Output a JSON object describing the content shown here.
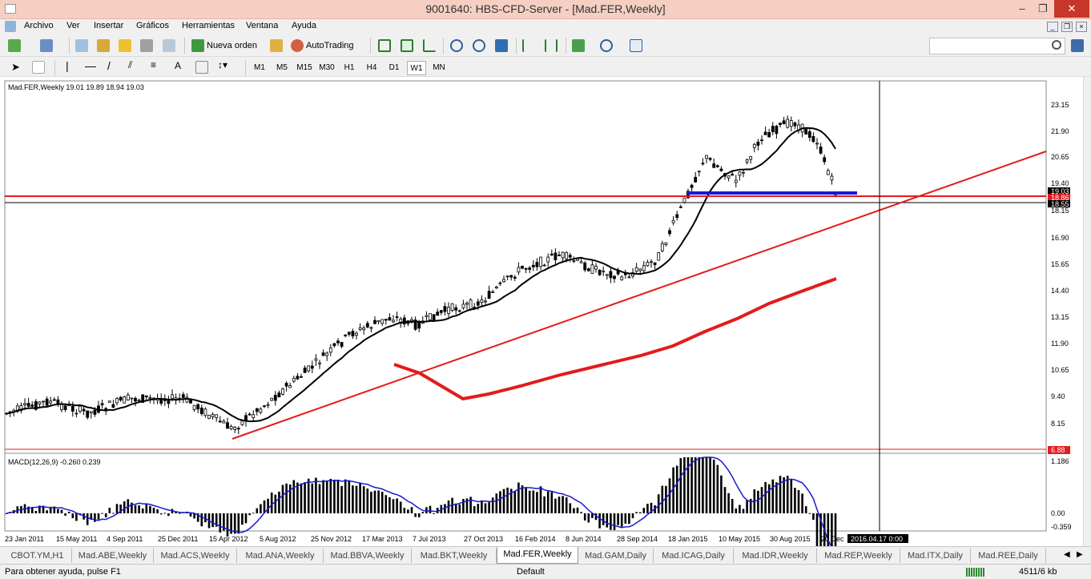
{
  "window": {
    "title": "9001640: HBS-CFD-Server - [Mad.FER,Weekly]",
    "minimize": "–",
    "restore": "❐",
    "close": "✕"
  },
  "menu": [
    "Archivo",
    "Ver",
    "Insertar",
    "Gráficos",
    "Herramientas",
    "Ventana",
    "Ayuda"
  ],
  "toolbar": {
    "new_order": "Nueva orden",
    "autotrading": "AutoTrading"
  },
  "drawing_tools": {
    "text_tool": "A"
  },
  "timeframes": [
    "M1",
    "M5",
    "M15",
    "M30",
    "H1",
    "H4",
    "D1",
    "W1",
    "MN"
  ],
  "active_timeframe": "W1",
  "chart": {
    "header": "Mad.FER,Weekly  19.01 19.89 18.94 19.03",
    "price_ticks": [
      "23.15",
      "21.90",
      "20.65",
      "19.40",
      "18.15",
      "16.90",
      "15.65",
      "14.40",
      "13.15",
      "11.90",
      "10.65",
      "9.40",
      "8.15"
    ],
    "price_labels": {
      "bid": "19.03",
      "line1": "18.86",
      "line2": "18.55",
      "low": "6.88"
    },
    "macd_header": "MACD(12,26,9) -0.260 0.239",
    "macd_ticks": [
      "1.186",
      "0.00",
      "-0.359"
    ],
    "date_ticks": [
      "23 Jan 2011",
      "15 May 2011",
      "4 Sep 2011",
      "25 Dec 2011",
      "15 Apr 2012",
      "5 Aug 2012",
      "25 Nov 2012",
      "17 Mar 2013",
      "7 Jul 2013",
      "27 Oct 2013",
      "16 Feb 2014",
      "8 Jun 2014",
      "28 Sep 2014",
      "18 Jan 2015",
      "10 May 2015",
      "30 Aug 2015",
      "20 Dec"
    ],
    "crosshair_date": "2016.04.17 0:00",
    "colors": {
      "candles": "#000000",
      "ma": "#000000",
      "trend": "#e31b1b",
      "support": "#1a1acf",
      "signal": "#1a1acf"
    }
  },
  "tabs": [
    "CBOT.YM,H1",
    "Mad.ABE,Weekly",
    "Mad.ACS,Weekly",
    "Mad.ANA,Weekly",
    "Mad.BBVA,Weekly",
    "Mad.BKT,Weekly",
    "Mad.FER,Weekly",
    "Mad.GAM,Daily",
    "Mad.ICAG,Daily",
    "Mad.IDR,Weekly",
    "Mad.REP,Weekly",
    "Mad.ITX,Daily",
    "Mad.REE,Daily"
  ],
  "active_tab": "Mad.FER,Weekly",
  "status": {
    "help": "Para obtener ayuda, pulse F1",
    "profile": "Default",
    "traffic": "4511/6 kb"
  }
}
